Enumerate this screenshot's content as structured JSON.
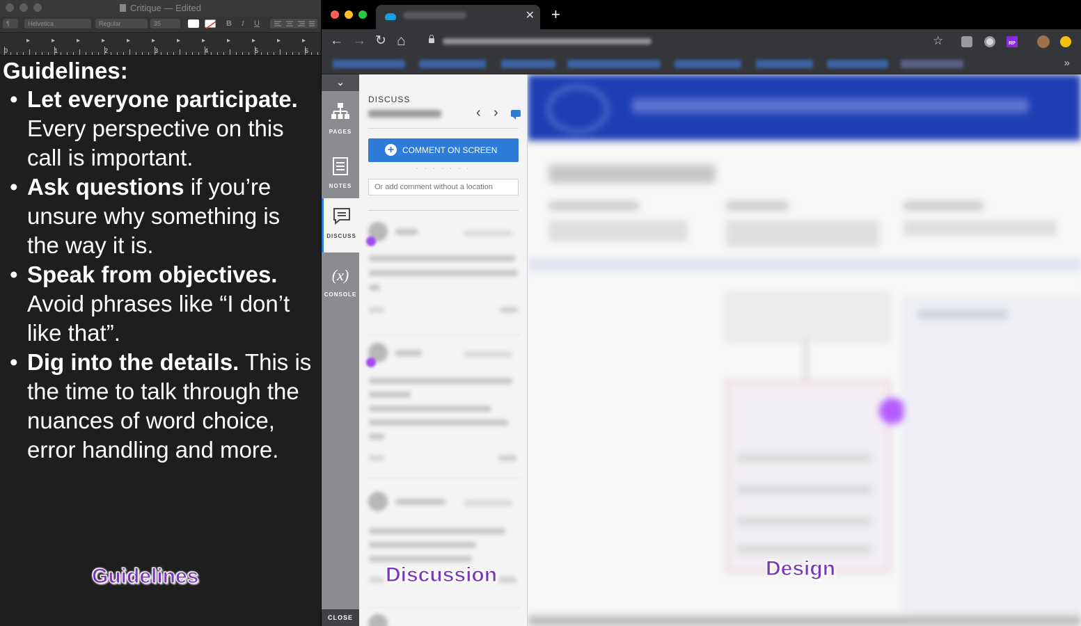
{
  "textedit": {
    "window_title": "Critique — Edited",
    "toolbar": {
      "paragraph_style": "¶",
      "font_family": "Helvetica",
      "font_style": "Regular",
      "font_size": "35",
      "bold": "B",
      "italic": "I",
      "underline": "U"
    },
    "ruler": {
      "numbers": [
        "0",
        "1",
        "2",
        "3",
        "4",
        "5",
        "6"
      ]
    },
    "heading": "Guidelines:",
    "guidelines": [
      {
        "bold": "Let everyone participate.",
        "text": " Every perspective on this call is important."
      },
      {
        "bold": "Ask questions",
        "text": " if you’re unsure why something is the way it is."
      },
      {
        "bold": "Speak from objectives.",
        "text": " Avoid phrases like “I don’t like that”."
      },
      {
        "bold": "Dig into the details.",
        "text": " This is the time to talk through the nuances of word choice, error handling and more."
      }
    ]
  },
  "browser": {
    "tab_close": "✕",
    "new_tab": "+",
    "bookmarks_more": "»",
    "nav": {
      "back": "←",
      "forward": "→",
      "reload": "↻",
      "home": "⌂",
      "star": "☆"
    },
    "extension_badge": "RP"
  },
  "tool_rail": {
    "collapse": "⌄",
    "items": [
      {
        "label": "PAGES",
        "icon": "sitemap-icon"
      },
      {
        "label": "NOTES",
        "icon": "notes-icon"
      },
      {
        "label": "DISCUSS",
        "icon": "discuss-icon",
        "active": true
      },
      {
        "label": "CONSOLE",
        "icon": "variable-icon",
        "glyph": "(x)"
      }
    ],
    "close": "CLOSE"
  },
  "discuss_panel": {
    "title": "DISCUSS",
    "prev": "‹",
    "next": "›",
    "comment_button": "COMMENT ON SCREEN",
    "input_placeholder": "Or add comment without a location",
    "colors": {
      "accent": "#2f7bd8",
      "pin": "#a04cf0"
    }
  },
  "captions": {
    "guidelines": "Guidelines",
    "discussion": "Discussion",
    "design": "Design",
    "color": "#7a36b8"
  }
}
